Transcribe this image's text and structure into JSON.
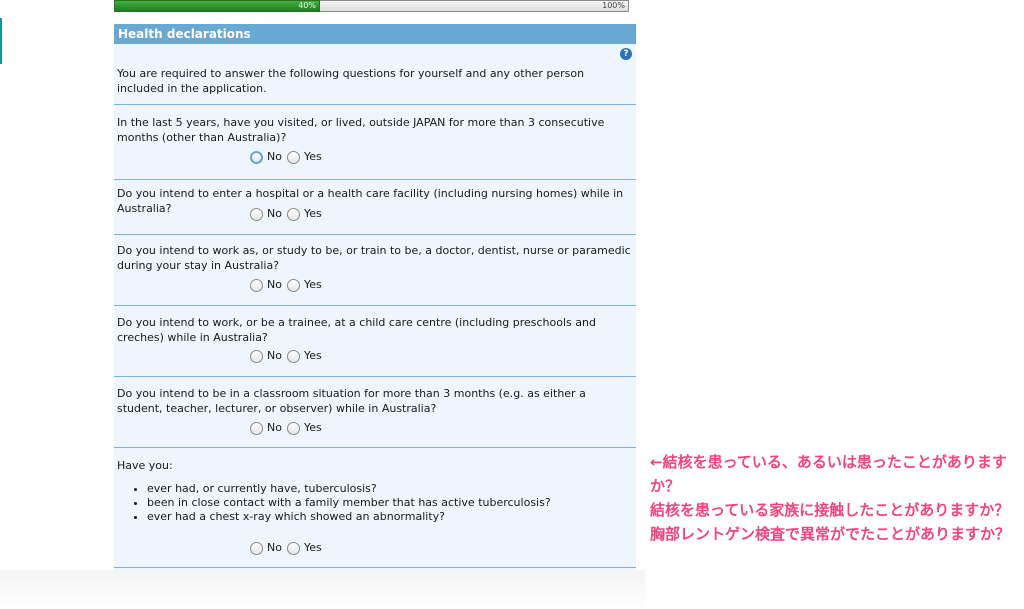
{
  "progress": {
    "current_label": "40%",
    "total_label": "100%",
    "fraction": 0.4,
    "fill_color": "#2f9a2f"
  },
  "panel": {
    "title": "Health declarations",
    "help_icon": "question-mark-circle-icon",
    "intro": "You are required to answer the following questions for yourself and any other person included in the application."
  },
  "questions": [
    {
      "text": "In the last 5 years, have you visited, or lived, outside JAPAN for more than 3 consecutive months (other than Australia)?",
      "no_label": "No",
      "yes_label": "Yes"
    },
    {
      "text": "Do you intend to enter a hospital or a health care facility (including nursing homes) while in Australia?",
      "no_label": "No",
      "yes_label": "Yes"
    },
    {
      "text": "Do you intend to work as, or study to be, or train to be, a doctor, dentist, nurse or paramedic during your stay in Australia?",
      "no_label": "No",
      "yes_label": "Yes"
    },
    {
      "text": "Do you intend to work, or be a trainee, at a child care centre (including preschools and creches) while in Australia?",
      "no_label": "No",
      "yes_label": "Yes"
    },
    {
      "text": "Do you intend to be in a classroom situation for more than 3 months (e.g. as either a student, teacher, lecturer, or observer) while in Australia?",
      "no_label": "No",
      "yes_label": "Yes"
    },
    {
      "text": "Have you:",
      "no_label": "No",
      "yes_label": "Yes",
      "bullets": [
        "ever had, or currently have, tuberculosis?",
        "been in close contact with a family member that has active tuberculosis?",
        "ever had a chest x-ray which showed an abnormality?"
      ]
    }
  ],
  "annotation": {
    "lines": [
      "←結核を患っている、あるいは患ったことがありますか？",
      "結核を患っている家族に接触したことがありますか？",
      "胸部レントゲン検査で異常がでたことがありますか？"
    ]
  }
}
